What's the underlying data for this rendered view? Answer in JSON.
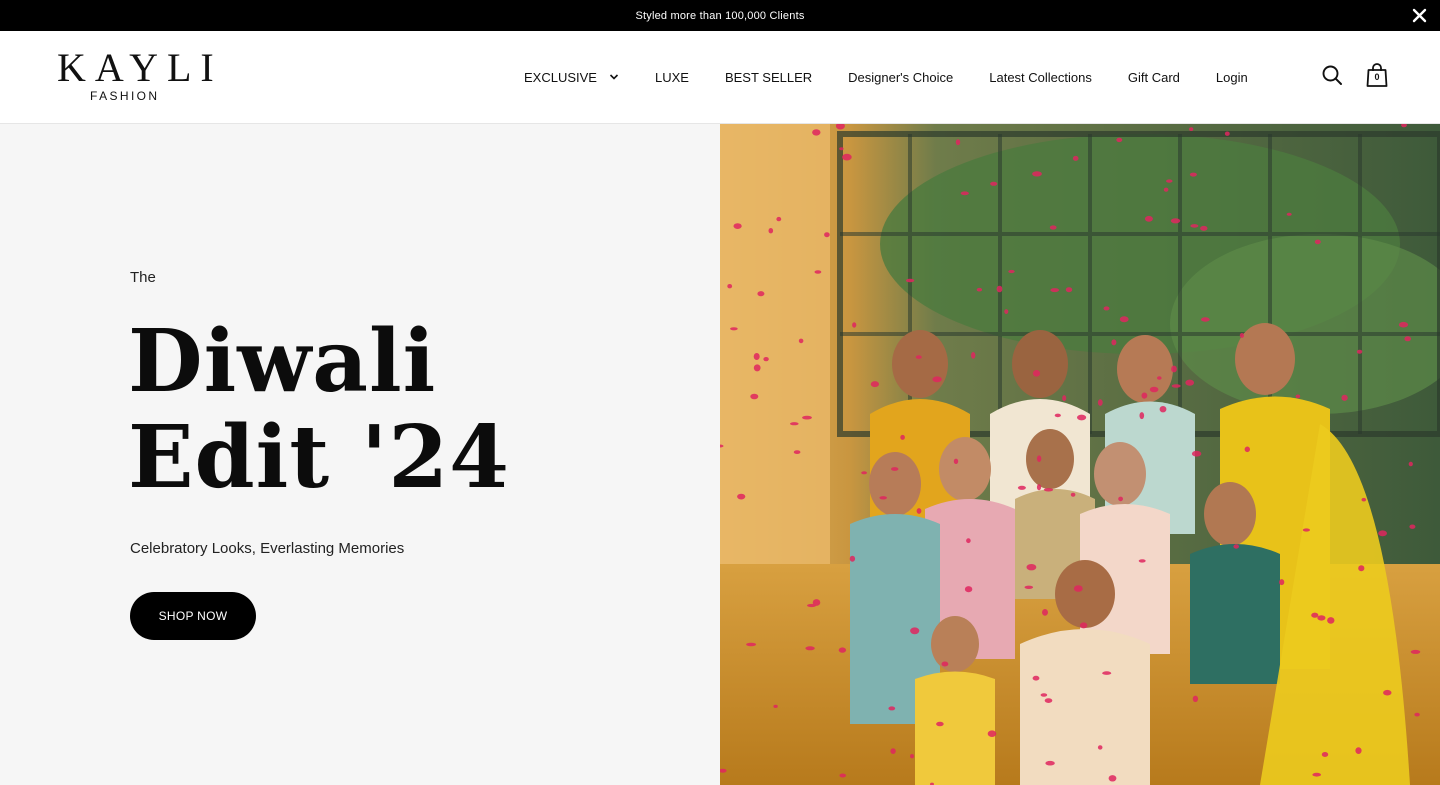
{
  "announcement": {
    "text": "Styled more than 100,000 Clients",
    "close_icon": "close-icon"
  },
  "brand": {
    "name": "KAYLI",
    "tagline": "FASHION"
  },
  "nav": {
    "items": [
      {
        "label": "EXCLUSIVE",
        "has_dropdown": true
      },
      {
        "label": "LUXE"
      },
      {
        "label": "BEST SELLER"
      },
      {
        "label": "Designer's Choice"
      },
      {
        "label": "Latest Collections"
      },
      {
        "label": "Gift Card"
      },
      {
        "label": "Login"
      }
    ]
  },
  "header_icons": {
    "search": "search-icon",
    "cart": "shopping-bag-icon",
    "cart_count": "0"
  },
  "hero": {
    "eyebrow": "The",
    "title_line1": "Diwali",
    "title_line2": "Edit '24",
    "subtitle": "Celebratory Looks, Everlasting Memories",
    "cta_label": "SHOP NOW"
  },
  "colors": {
    "announcement_bg": "#000000",
    "hero_left_bg": "#f6f6f6",
    "cta_bg": "#000000",
    "cta_text": "#ffffff"
  }
}
